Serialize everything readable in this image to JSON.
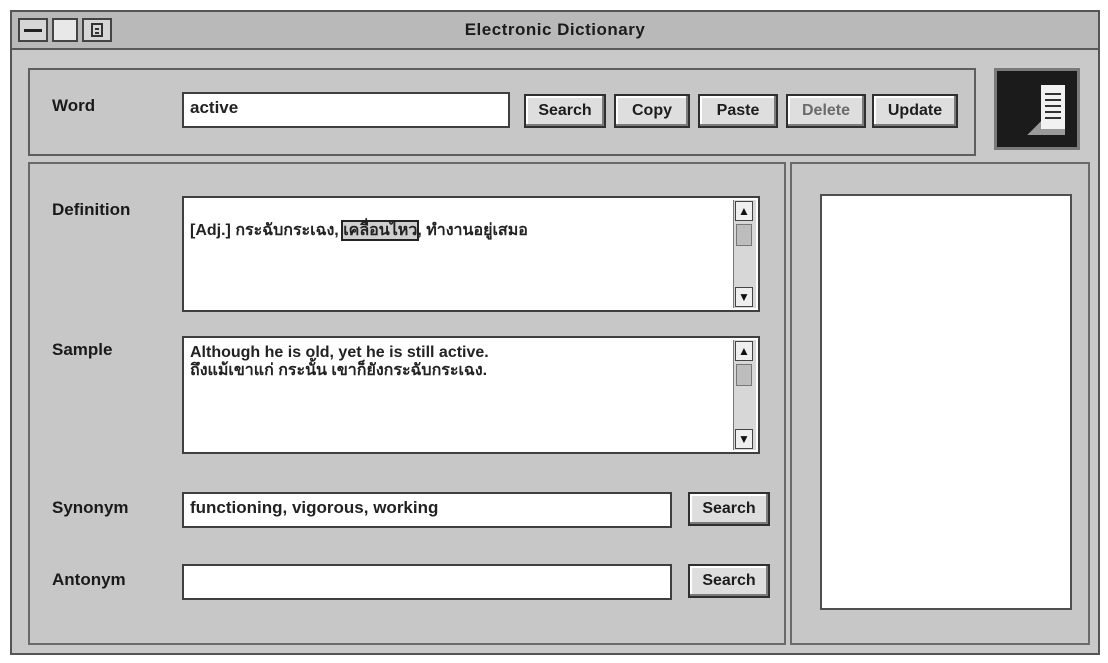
{
  "window": {
    "title": "Electronic Dictionary"
  },
  "icons": {
    "system_menu": "system-menu-icon",
    "minimize": "minimize-icon",
    "document": "document-icon",
    "app": "dictionary-app-icon"
  },
  "word": {
    "label": "Word",
    "value": "active"
  },
  "toolbar": {
    "search_label": "Search",
    "copy_label": "Copy",
    "paste_label": "Paste",
    "delete_label": "Delete",
    "update_label": "Update"
  },
  "definition": {
    "label": "Definition",
    "prefix": "[Adj.] กระฉับกระเฉง, ",
    "highlight": "เคลื่อนไหว",
    "suffix": ", ทำงานอยู่เสมอ"
  },
  "sample": {
    "label": "Sample",
    "text": "Although he is old, yet he is still active.\nถึงแม้เขาแก่ กระนั้น เขาก็ยังกระฉับกระเฉง."
  },
  "synonym": {
    "label": "Synonym",
    "value": "functioning, vigorous, working",
    "search_label": "Search"
  },
  "antonym": {
    "label": "Antonym",
    "value": "",
    "search_label": "Search"
  }
}
